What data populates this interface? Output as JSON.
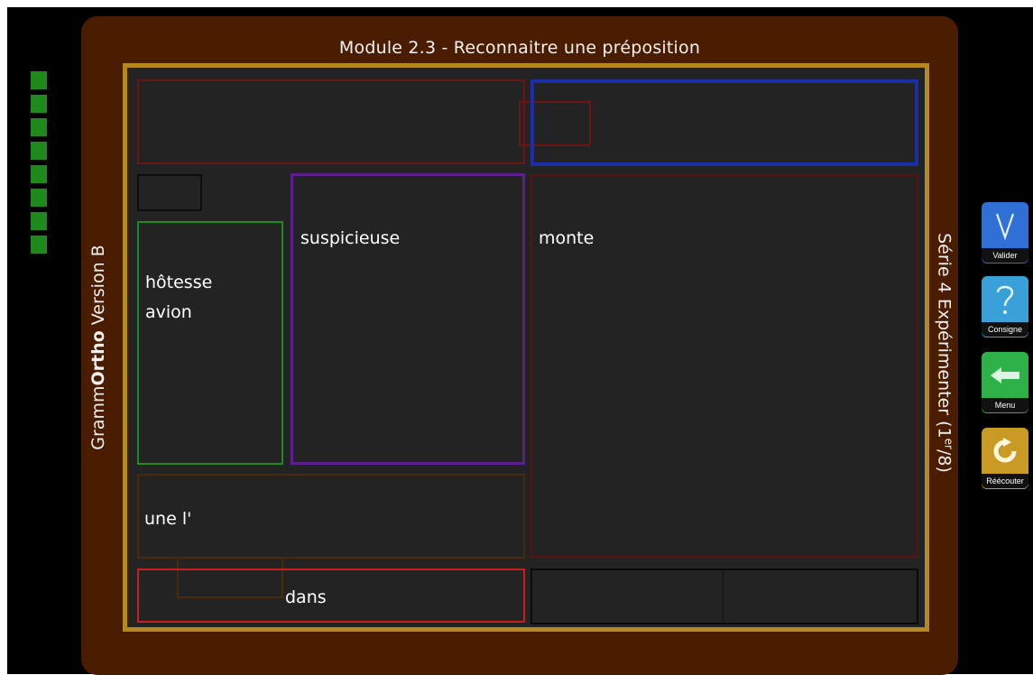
{
  "module_title": "Module 2.3 - Reconnaitre une préposition",
  "side_left": {
    "brand_prefix": "Gramm",
    "brand_bold": "Ortho",
    "version": " Version B"
  },
  "side_right": {
    "text": "Série 4 Expérimenter (1",
    "sup": "er",
    "suffix": "/8)"
  },
  "progress_count": 8,
  "words": {
    "hotesse": "hôtesse",
    "avion": "avion",
    "suspicieuse": "suspicieuse",
    "monte": "monte",
    "une_l": "une l'",
    "dans": "dans"
  },
  "toolbar": [
    {
      "key": "valider",
      "label": "Valider",
      "color": "#2f6fd6",
      "icon": "check-v-icon"
    },
    {
      "key": "consigne",
      "label": "Consigne",
      "color": "#3aa0d8",
      "icon": "question-icon"
    },
    {
      "key": "menu",
      "label": "Menu",
      "color": "#2fb14a",
      "icon": "arrow-left-icon"
    },
    {
      "key": "reecouter",
      "label": "Réécouter",
      "color": "#c99b24",
      "icon": "replay-icon"
    }
  ]
}
